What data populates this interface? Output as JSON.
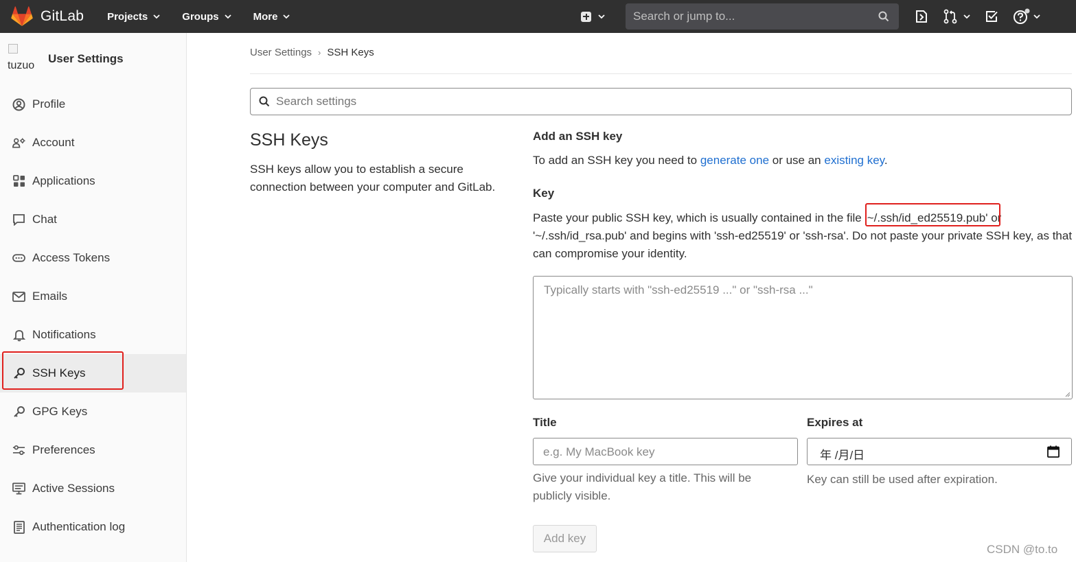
{
  "navbar": {
    "brand": "GitLab",
    "menu": [
      "Projects",
      "Groups",
      "More"
    ],
    "search_placeholder": "Search or jump to...",
    "icons": [
      "plus-icon",
      "search-icon",
      "issues-icon",
      "merge-request-icon",
      "todo-icon",
      "help-icon"
    ]
  },
  "sidebar": {
    "avatar_alt": "tuzuo",
    "title": "User Settings",
    "items": [
      {
        "label": "Profile",
        "icon": "profile-icon"
      },
      {
        "label": "Account",
        "icon": "account-icon"
      },
      {
        "label": "Applications",
        "icon": "applications-icon"
      },
      {
        "label": "Chat",
        "icon": "chat-icon"
      },
      {
        "label": "Access Tokens",
        "icon": "token-icon"
      },
      {
        "label": "Emails",
        "icon": "email-icon"
      },
      {
        "label": "Notifications",
        "icon": "bell-icon"
      },
      {
        "label": "SSH Keys",
        "icon": "key-icon"
      },
      {
        "label": "GPG Keys",
        "icon": "key-icon"
      },
      {
        "label": "Preferences",
        "icon": "preferences-icon"
      },
      {
        "label": "Active Sessions",
        "icon": "monitor-icon"
      },
      {
        "label": "Authentication log",
        "icon": "log-icon"
      }
    ]
  },
  "breadcrumb": {
    "parent": "User Settings",
    "current": "SSH Keys"
  },
  "settings_search": {
    "placeholder": "Search settings"
  },
  "section": {
    "title": "SSH Keys",
    "description": "SSH keys allow you to establish a secure connection between your computer and GitLab."
  },
  "form": {
    "add_heading": "Add an SSH key",
    "add_text_before": "To add an SSH key you need to ",
    "generate_link": "generate one",
    "add_text_middle": " or use an ",
    "existing_link": "existing key",
    "add_text_after": ".",
    "key_label": "Key",
    "key_help_before": "Paste your public SSH key, which is usually contained in the file ",
    "key_file": "'~/.ssh/id_ed25519.pub'",
    "key_help_after": " or '~/.ssh/id_rsa.pub' and begins with 'ssh-ed25519' or 'ssh-rsa'. Do not paste your private SSH key, as that can compromise your identity.",
    "key_placeholder": "Typically starts with \"ssh-ed25519 ...\" or \"ssh-rsa ...\"",
    "title_label": "Title",
    "title_placeholder": "e.g. My MacBook key",
    "title_help": "Give your individual key a title. This will be publicly visible.",
    "expires_label": "Expires at",
    "expires_value": "年 /月/日",
    "expires_help": "Key can still be used after expiration.",
    "submit": "Add key"
  },
  "watermark": "CSDN @to.to",
  "colors": {
    "navbar": "#303030",
    "link": "#1f6fd0",
    "highlight": "#e0201d"
  }
}
